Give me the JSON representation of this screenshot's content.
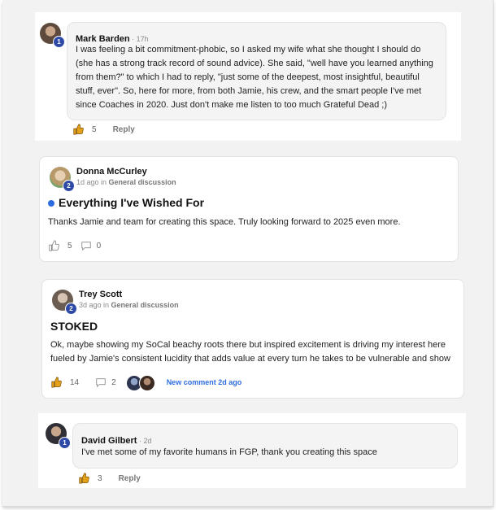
{
  "comment1": {
    "author": "Mark Barden",
    "time": " · 17h",
    "badge": "1",
    "text": "I was feeling a bit commitment-phobic, so I asked my wife what she thought I should do (she has a strong track record of sound advice). She said, \"well have you learned anything from them?\" to which I had to reply, \"just some of the deepest, most insightful, beautiful stuff, ever\". So, here for more, from both Jamie, his crew, and the smart people I've met since Coaches in 2020. Just don't make me listen to too much Grateful Dead ;)",
    "likes": "5",
    "reply": "Reply"
  },
  "post1": {
    "author": "Donna McCurley",
    "badge": "2",
    "ago": "1d ago in ",
    "category": "General discussion",
    "title": "Everything I've Wished For",
    "text": "Thanks Jamie and team for creating this space. Truly looking forward to 2025 even more.",
    "likes": "5",
    "comments": "0"
  },
  "post2": {
    "author": "Trey Scott",
    "badge": "2",
    "ago": "3d ago in ",
    "category": "General discussion",
    "title": "STOKED",
    "text": "Ok, maybe showing my SoCal beachy roots there but inspired excitement is driving my interest here fueled by Jamie's consistent lucidity that adds value at every turn he takes to be vulnerable and show",
    "likes": "14",
    "comments": "2",
    "new_comment": "New comment 2d ago"
  },
  "comment2": {
    "author": "David Gilbert",
    "time": " · 2d",
    "badge": "1",
    "text": "I've met some of my favorite humans in FGP, thank you creating this space",
    "likes": "3",
    "reply": "Reply"
  },
  "colors": {
    "accent": "#2d6cdf",
    "badge": "#2f4aa6",
    "like_active": "#e3a21a",
    "like_inactive": "#8a8a8a"
  }
}
